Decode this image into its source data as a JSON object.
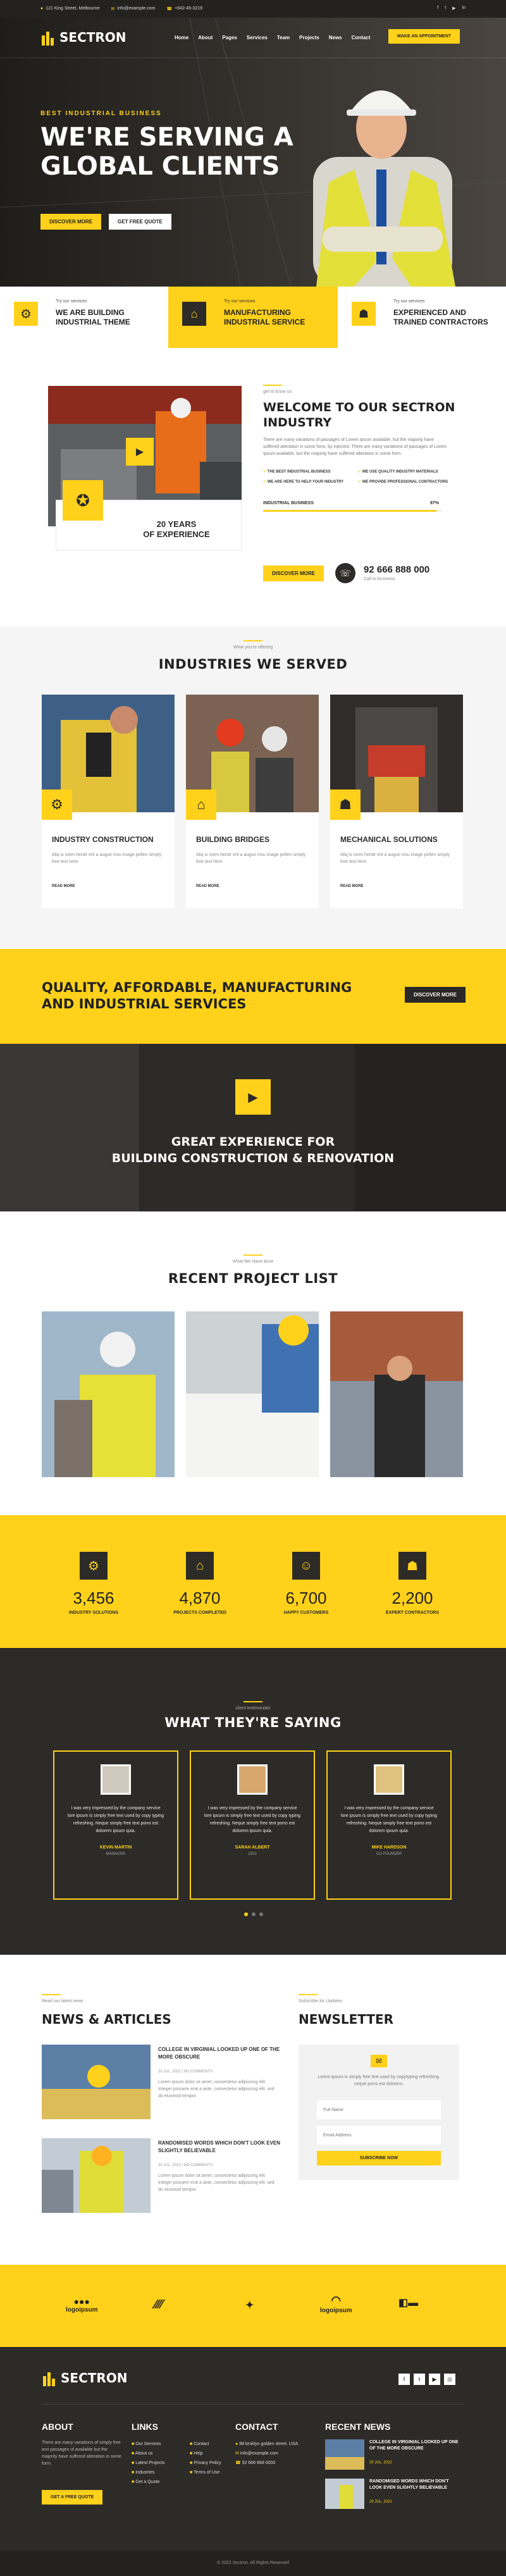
{
  "topbar": {
    "address": "121 King Street, Melbourne",
    "email": "info@example.com",
    "phone": "+642-45-3219",
    "social": [
      "f",
      "t",
      "▶",
      "in"
    ]
  },
  "header": {
    "brand": "SECTRON",
    "nav": [
      "Home",
      "About",
      "Pages",
      "Services",
      "Team",
      "Projects",
      "News",
      "Contact"
    ],
    "cta": "Make an appointment"
  },
  "hero": {
    "kicker": "BEST INDUSTRIAL BUSINESS",
    "title_line1": "WE'RE SERVING A",
    "title_line2": "GLOBAL CLIENTS",
    "btn1": "Discover more",
    "btn2": "Get free quote"
  },
  "features": [
    {
      "kicker": "Try our services",
      "title_line1": "WE ARE BUILDING",
      "title_line2": "INDUSTRIAL THEME"
    },
    {
      "kicker": "Try our services",
      "title_line1": "MANUFACTURING",
      "title_line2": "INDUSTRIAL SERVICE"
    },
    {
      "kicker": "Try our services",
      "title_line1": "EXPERIENCED AND",
      "title_line2": "TRAINED CONTRACTORS"
    }
  ],
  "about": {
    "years_line1": "20 YEARS",
    "years_line2": "OF EXPERIENCE",
    "kicker": "get to know us",
    "title_line1": "WELCOME TO OUR SECTRON",
    "title_line2": "INDUSTRY",
    "text": "There are many variations of passages of Lorem Ipsum available, but the majority have suffered alteration in some form, by injected. There are many variations of passages of Lorem Ipsum available, but the majority have suffered alteration in some form.",
    "checks": [
      "THE BEST INDUSTRIAL BUSINESS",
      "WE USE QUALITY INDUSTRY MATERIALS",
      "WE ARE HERE TO HELP YOUR INDUSTRY",
      "WE PROVIDE PROFESSIONAL CONTRACTORS"
    ],
    "progress_label": "INDUSTRIAL BUSINESS",
    "progress_value": "97%",
    "progress_fraction": 0.97,
    "btn": "Discover more",
    "phone": "92 666 888 000",
    "phone_label": "Call to business"
  },
  "industries": {
    "kicker": "What you're offering",
    "title": "INDUSTRIES WE SERVED",
    "items": [
      {
        "title": "INDUSTRY CONSTRUCTION",
        "text": "Aliq is notm hendr erit a augue insu image pellen simply free text here.",
        "link": "READ MORE"
      },
      {
        "title": "BUILDING BRIDGES",
        "text": "Aliq is notm hendr erit a augue insu image pellen simply free text here.",
        "link": "READ MORE"
      },
      {
        "title": "MECHANICAL SOLUTIONS",
        "text": "Aliq is notm hendr erit a augue insu image pellen simply free text here.",
        "link": "READ MORE"
      }
    ]
  },
  "cta_band": {
    "line1": "QUALITY, AFFORDABLE, MANUFACTURING",
    "line2": "AND INDUSTRIAL SERVICES",
    "btn": "Discover more"
  },
  "video": {
    "line1": "GREAT EXPERIENCE FOR",
    "line2": "BUILDING CONSTRUCTION & RENOVATION"
  },
  "projects": {
    "kicker": "What We Have done",
    "title": "RECENT PROJECT LIST"
  },
  "stats": [
    {
      "value": "3,456",
      "label": "INDUSTRY SOLUTIONS"
    },
    {
      "value": "4,870",
      "label": "PROJECTS COMPLETED"
    },
    {
      "value": "6,700",
      "label": "HAPPY CUSTOMERS"
    },
    {
      "value": "2,200",
      "label": "EXPERT CONTRACTORS"
    }
  ],
  "testimonials": {
    "kicker": "client testimonials",
    "title": "WHAT THEY'RE SAYING",
    "items": [
      {
        "text": "I was very impressed by the company service lore ipsum is simply free text used by copy typing refreshing. Neque simply free text porro est dolorem ipsum quia.",
        "name": "KEVIN MARTIN",
        "role": "MANAGER"
      },
      {
        "text": "I was very impressed by the company service lore ipsum is simply free text used by copy typing refreshing. Neque simply free text porro est dolorem ipsum quia.",
        "name": "SARAH ALBERT",
        "role": "CEO"
      },
      {
        "text": "I was very impressed by the company service lore ipsum is simply free text used by copy typing refreshing. Neque simply free text porro est dolorem ipsum quia.",
        "name": "MIKE HARDSON",
        "role": "CO FOUNDER"
      }
    ]
  },
  "news": {
    "kicker": "Read our latest news",
    "title": "NEWS & ARTICLES",
    "items": [
      {
        "title": "COLLEGE IN VIRGINIAL LOOKED UP ONE OF THE MORE OBSCURE",
        "meta": "20 JUL, 2022  |  NO COMMENTS",
        "text": "Lorem ipsum dolor sit amet, consectetur adipiscing elit. Integer posuere erat a ante, consectetur adipiscing elit. sed do eiusmod tempor."
      },
      {
        "title": "RANDOMISED WORDS WHICH DON'T LOOK EVEN SLIGHTLY BELIEVABLE",
        "meta": "20 JUL, 2022  |  NO COMMENTS",
        "text": "Lorem ipsum dolor sit amet, consectetur adipiscing elit. Integer posuere erat a ante, consectetur adipiscing elit. sed do eiusmod tempor."
      }
    ]
  },
  "newsletter": {
    "kicker": "Subscribe for Updates",
    "title": "NEWSLETTER",
    "text": "Lorem ipsum is simply free text used by copytyping refreshing. neque porro est dolorem.",
    "name_placeholder": "Full Name",
    "email_placeholder": "Email Address",
    "btn": "Subscribe now"
  },
  "brands": [
    "logoipsum",
    "",
    "",
    "logoipsum",
    ""
  ],
  "footer": {
    "brand": "SECTRON",
    "about_title": "ABOUT",
    "about_text": "There are many variations of simply free text passages of available but the majority have suffered alteration in some form.",
    "about_btn": "Get a free quote",
    "links_title": "LINKS",
    "links_col1": [
      "Our Services",
      "About us",
      "Latest Projects",
      "Industries",
      "Get a Quote"
    ],
    "links_col2": [
      "Contact",
      "Help",
      "Privacy Policy",
      "Terms of Use"
    ],
    "contact_title": "CONTACT",
    "contact": [
      "88 broklyn golden street, USA",
      "info@example.com",
      "92 666 888 0000"
    ],
    "news_title": "RECENT NEWS",
    "news": [
      {
        "title": "COLLEGE IN VIRGINIAL LOOKED UP ONE OF THE MORE OBSCURE",
        "date": "20 JUL, 2022"
      },
      {
        "title": "RANDOMISED WORDS WHICH DON'T LOOK EVEN SLIGHTLY BELIEVABLE",
        "date": "20 JUL, 2022"
      }
    ],
    "copyright": "© 2022 Sectron. All Rights Reserved"
  },
  "colors": {
    "accent": "#ffd11a",
    "dark": "#2d2b28"
  }
}
